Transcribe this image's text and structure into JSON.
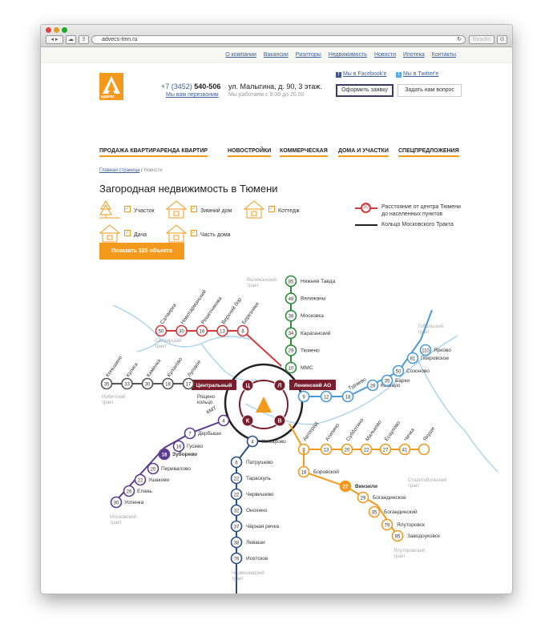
{
  "browser": {
    "url": "advecs-tmn.ru",
    "reader": "Reader"
  },
  "topnav": [
    "О компании",
    "Вакансии",
    "Риэлторы",
    "Недвижимость",
    "Новости",
    "Ипотека",
    "Контакты"
  ],
  "header": {
    "phone_code": "+7 (3452)",
    "phone_num": "540-506",
    "callback": "Мы вам перезвоним",
    "address": "ул. Малыгина, д. 90, 3 этаж.",
    "hours": "Мы работаем с 9.00 до 20.00",
    "facebook": "Мы в Facebook'e",
    "twitter": "Мы в Twitter'e",
    "order_btn": "Оформить заявку",
    "ask_btn": "Задать нам вопрос",
    "logo_text": "адвекс"
  },
  "mainnav": [
    "ПРОДАЖА КВАРТИР",
    "АРЕНДА КВАРТИР",
    "НОВОСТРОЙКИ",
    "КОММЕРЧЕСКАЯ",
    "ДОМА И УЧАСТКИ",
    "СПЕЦПРЕДЛОЖЕНИЯ"
  ],
  "breadcrumb": {
    "home": "Главная страница",
    "sep": "/",
    "current": "Новости"
  },
  "title": "Загородная недвижимость в Тюмени",
  "filters": [
    {
      "label": "Участок",
      "icon": "tree-icon",
      "checked": true
    },
    {
      "label": "Зимний дом",
      "icon": "house-icon",
      "checked": true
    },
    {
      "label": "Коттедж",
      "icon": "cottage-icon",
      "checked": true
    },
    {
      "label": "Дача",
      "icon": "dacha-icon",
      "checked": true
    },
    {
      "label": "Часть дома",
      "icon": "house-part-icon",
      "checked": true
    }
  ],
  "legend": {
    "dist_num": "30",
    "dist_text1": "Расстояние от центра Тюмени",
    "dist_text2": "до населенных пунктов",
    "ring_text": "Кольцо Московского Тракта"
  },
  "show_btn": "Показать 325 объекта",
  "map": {
    "tracts": [
      "Велижанский тракт",
      "Салаирский тракт",
      "Тобольский тракт",
      "Ирбитский тракт",
      "Старотобольский тракт",
      "Московский тракт",
      "Червишевский тракт",
      "Ялуторовский тракт"
    ],
    "tags": {
      "central": "Центральный",
      "leninsky": "Ленинский АО"
    },
    "hub": [
      "Ц",
      "Л",
      "К",
      "В"
    ],
    "ring_label": "Рощино кольцо",
    "green": [
      [
        "85",
        "Нижняя Тавда"
      ],
      [
        "48",
        "Велижаны"
      ],
      [
        "38",
        "Московка"
      ],
      [
        "34",
        "Караганский"
      ],
      [
        "29",
        "Тюмено"
      ],
      [
        "10",
        "ММС"
      ]
    ],
    "red": [
      [
        "50",
        "Салаирка"
      ],
      [
        "30",
        "Новотарманский"
      ],
      [
        "16",
        "Решетникова"
      ],
      [
        "13",
        "Верхний бор"
      ],
      [
        "8",
        "Березняки"
      ]
    ],
    "gray": [
      [
        "35",
        "Коньшино"
      ],
      [
        "33",
        "Кулига"
      ],
      [
        "30",
        "Каменка"
      ],
      [
        "18",
        "Кулаково"
      ],
      [
        "17",
        "Луговое"
      ]
    ],
    "rosh": "Рощино",
    "blue": [
      [
        "9",
        ""
      ],
      [
        "12",
        ""
      ],
      [
        "18",
        "Тураево"
      ],
      [
        "26",
        "Каскаро"
      ],
      [
        "35",
        "Барки"
      ],
      [
        "50",
        "Созоново"
      ],
      [
        "81",
        "Покровское"
      ],
      [
        "110",
        "Ярково"
      ]
    ],
    "purple": [
      [
        "4",
        "КМТ"
      ],
      [
        "7",
        "Дербыши"
      ],
      [
        "16",
        "Гусево"
      ],
      [
        "18",
        "Зуборево"
      ],
      [
        "20",
        "Перевалово"
      ],
      [
        "22",
        "Ушаково"
      ],
      [
        "26",
        "Елань"
      ],
      [
        "30",
        "Успенка"
      ]
    ],
    "navy": [
      [
        "4",
        "Комарово"
      ],
      [
        "6",
        "Патрушево"
      ],
      [
        "22",
        "Тараскуль"
      ],
      [
        "22",
        "Червишево"
      ],
      [
        "32",
        "Онохино"
      ],
      [
        "37",
        "Чёрная речка"
      ],
      [
        "38",
        "Леваши"
      ],
      [
        "76",
        "Исетское"
      ]
    ],
    "orange": [
      [
        "8",
        "Автоград"
      ],
      [
        "13",
        "Атипино"
      ],
      [
        "20",
        "Субботино"
      ],
      [
        "22",
        "Мальково"
      ],
      [
        "27",
        "Ёсаулово"
      ],
      [
        "41",
        "Чичка"
      ],
      [
        "",
        "Якуши"
      ]
    ],
    "orange2": [
      [
        "18",
        "Боровской"
      ],
      [
        "27",
        "Винзили"
      ],
      [
        "29",
        "Богандинское"
      ],
      [
        "35",
        "Богандинский"
      ],
      [
        "79",
        "Ялуторовск"
      ],
      [
        "95",
        "Заводоуковск"
      ]
    ]
  },
  "colors": {
    "green": "#2e8b3e",
    "red": "#d33a3a",
    "gray": "#555555",
    "blue": "#4a9ad8",
    "purple": "#5b3c8e",
    "navy": "#2c4f86",
    "orange": "#f39a1e",
    "maroon": "#7a1e2e",
    "river": "#a8d4ef"
  }
}
